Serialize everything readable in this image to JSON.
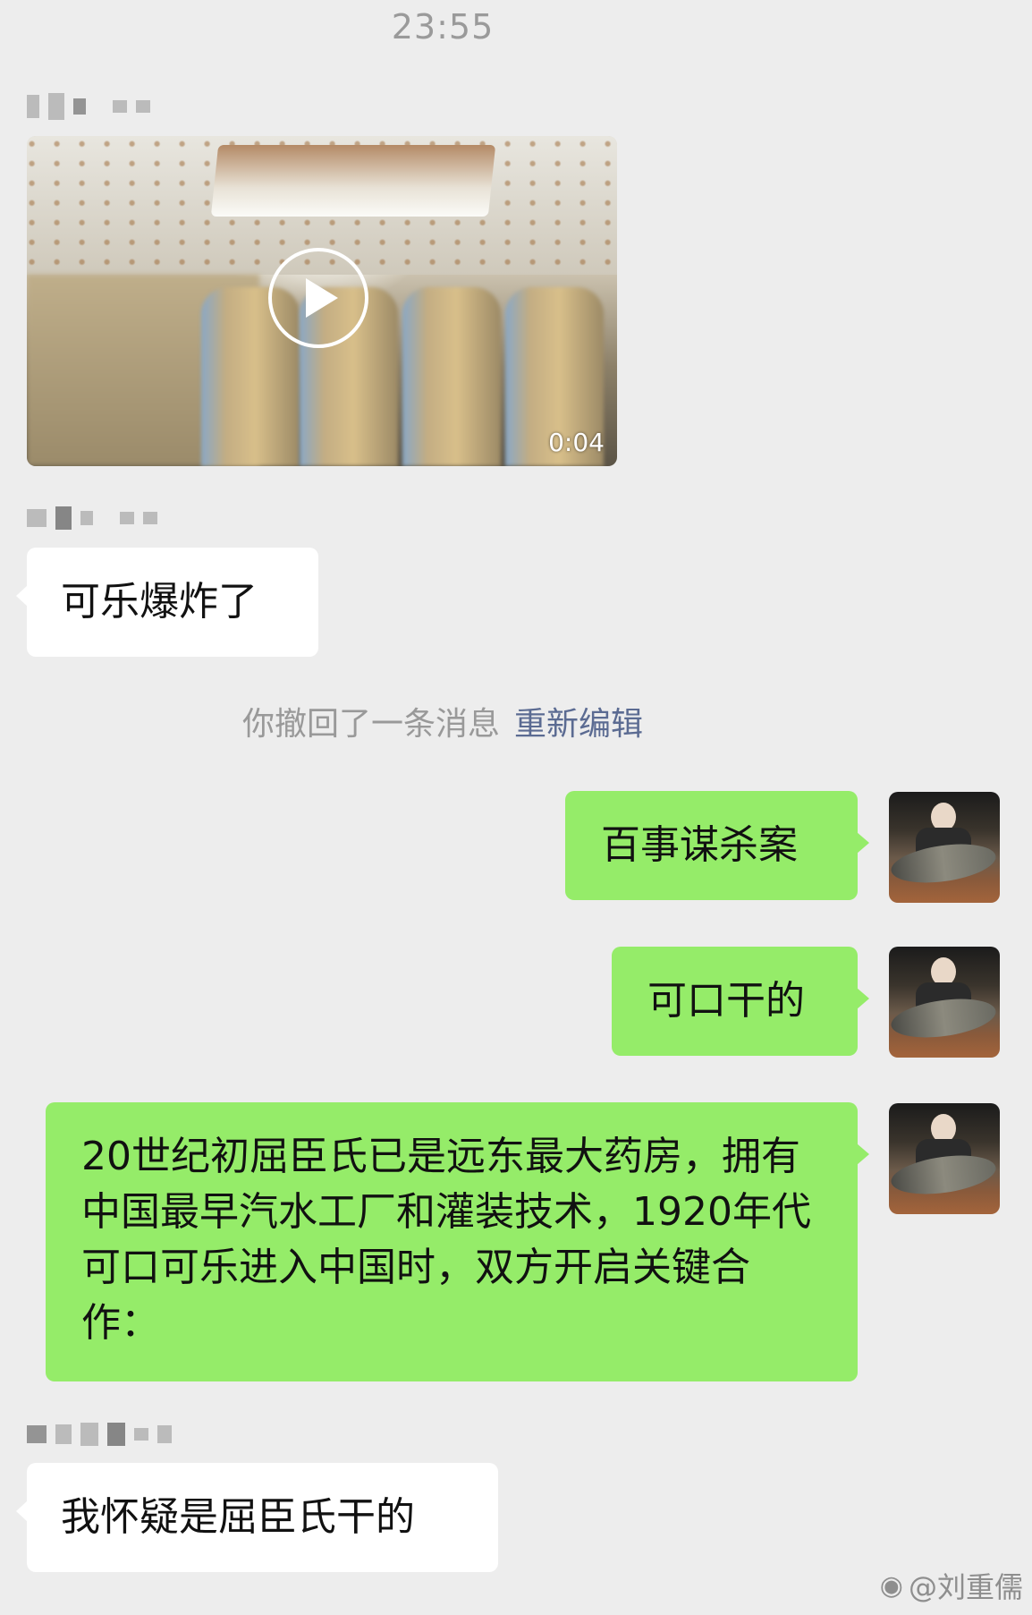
{
  "status": {
    "time": "23:55"
  },
  "messages": {
    "video": {
      "duration": "0:04"
    },
    "m1": "可乐爆炸了",
    "recall": {
      "text": "你撤回了一条消息",
      "action": "重新编辑"
    },
    "m2": "百事谋杀案",
    "m3": "可口干的",
    "m4": "20世纪初屈臣氏已是远东最大药房，拥有中国最早汽水工厂和灌装技术，1920年代可口可乐进入中国时，双方开启关键合作：",
    "m5": "我怀疑是屈臣氏干的"
  },
  "watermark": {
    "text": "@刘重儒",
    "icon": "weibo-icon"
  },
  "colors": {
    "background": "#ededed",
    "sent_bubble": "#95ec69",
    "received_bubble": "#ffffff",
    "link": "#5b6b92"
  }
}
